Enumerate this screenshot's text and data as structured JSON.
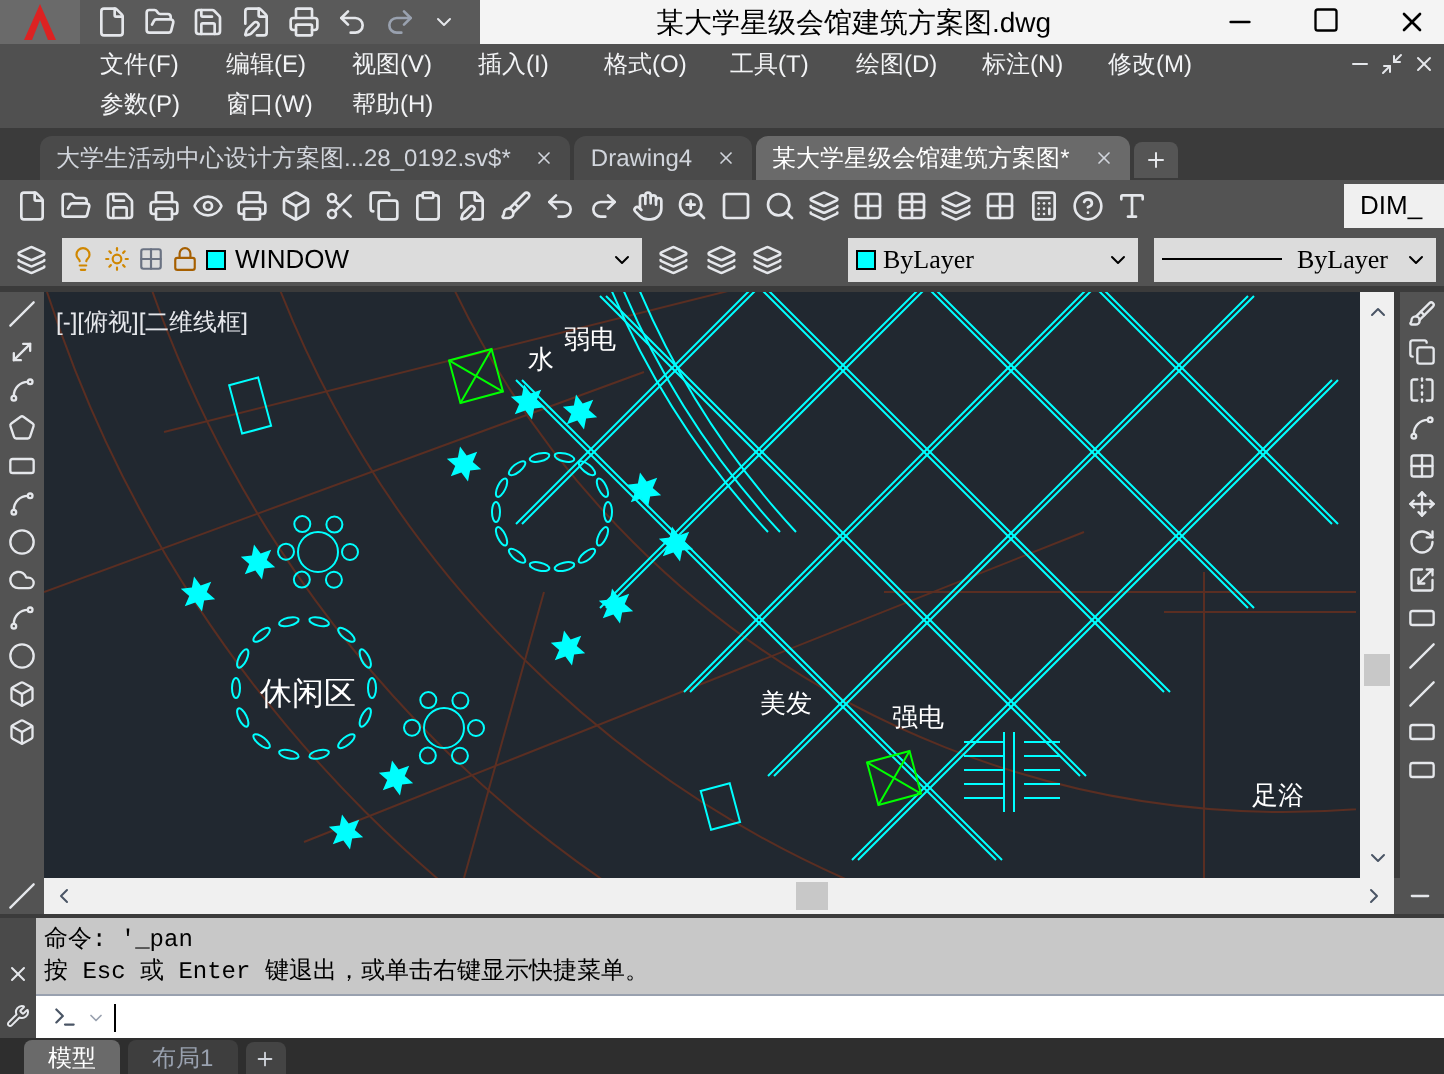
{
  "app": {
    "title": "某大学星级会馆建筑方案图.dwg"
  },
  "menu_rows": [
    [
      {
        "label": "文件(F)"
      },
      {
        "label": "编辑(E)"
      },
      {
        "label": "视图(V)"
      },
      {
        "label": "插入(I)"
      },
      {
        "label": "格式(O)"
      },
      {
        "label": "工具(T)"
      },
      {
        "label": "绘图(D)"
      },
      {
        "label": "标注(N)"
      },
      {
        "label": "修改(M)"
      }
    ],
    [
      {
        "label": "参数(P)"
      },
      {
        "label": "窗口(W)"
      },
      {
        "label": "帮助(H)"
      }
    ]
  ],
  "document_tabs": [
    {
      "label": "大学生活动中心设计方案图...28_0192.sv$*",
      "selected": false
    },
    {
      "label": "Drawing4",
      "selected": false
    },
    {
      "label": "某大学星级会馆建筑方案图*",
      "selected": true
    }
  ],
  "toolbar": {
    "text_style": "DIM_"
  },
  "layer_bar": {
    "layer": "WINDOW",
    "color_setting": "ByLayer",
    "linetype": "ByLayer"
  },
  "viewport": {
    "label": "[-][俯视][二维线框]",
    "room_labels": [
      {
        "text": "水"
      },
      {
        "text": "弱电"
      },
      {
        "text": "休闲区"
      },
      {
        "text": "美发"
      },
      {
        "text": "强电"
      },
      {
        "text": "足浴"
      }
    ]
  },
  "command": {
    "history": [
      "命令: '_pan",
      "按 Esc 或 Enter 键退出，或单击右键显示快捷菜单。"
    ]
  },
  "layout_tabs": [
    {
      "label": "模型",
      "selected": true
    },
    {
      "label": "布局1",
      "selected": false
    }
  ]
}
